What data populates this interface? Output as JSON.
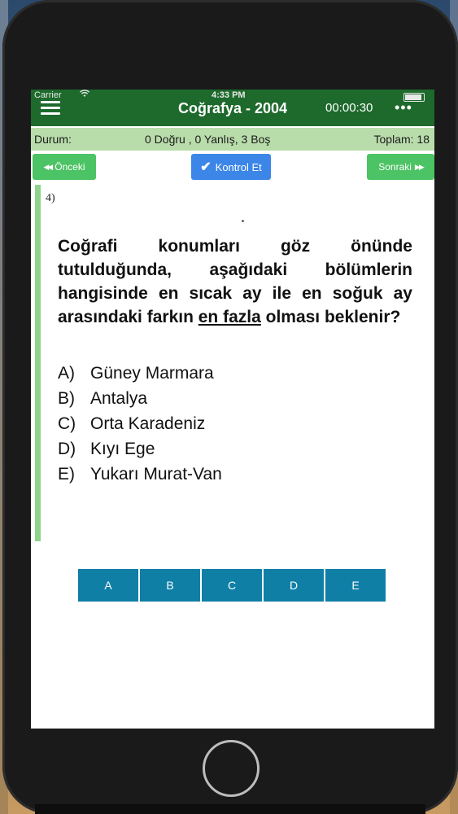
{
  "status_bar": {
    "carrier": "Carrier",
    "wifi_icon": "wifi-icon",
    "time": "4:33 PM",
    "battery_icon": "battery-icon"
  },
  "navbar": {
    "menu_icon": "hamburger-menu-icon",
    "title": "Coğrafya - 2004",
    "timer": "00:00:30",
    "more_icon": "ellipsis-icon",
    "more_glyph": "•••",
    "background_color": "#1d6a2c"
  },
  "summary": {
    "status_label": "Durum:",
    "results": "0 Doğru , 0 Yanlış, 3 Boş",
    "total": "Toplam: 18",
    "background_color": "#b9dcab"
  },
  "toolbar": {
    "prev_label": "Önceki",
    "prev_icon": "rewind-icon",
    "prev_glyph": "◀◀",
    "check_label": "Kontrol Et",
    "check_icon": "checkmark-icon",
    "check_glyph": "✔",
    "next_label": "Sonraki",
    "next_icon": "fast-forward-icon",
    "next_glyph": "▶▶"
  },
  "question": {
    "number": "4)",
    "text_before": "Coğrafi konumları göz önünde tutulduğunda, aşağıdaki bölümlerin hangisinde en sıcak ay ile en soğuk ay arasındaki farkın ",
    "emphasis": "en fazla",
    "text_after": " olması beklenir?",
    "options": [
      {
        "letter": "A)",
        "text": "Güney Marmara"
      },
      {
        "letter": "B)",
        "text": "Antalya"
      },
      {
        "letter": "C)",
        "text": "Orta Karadeniz"
      },
      {
        "letter": "D)",
        "text": "Kıyı Ege"
      },
      {
        "letter": "E)",
        "text": "Yukarı Murat-Van"
      }
    ]
  },
  "answers": {
    "buttons": [
      "A",
      "B",
      "C",
      "D",
      "E"
    ],
    "color": "#0f7fa6"
  }
}
